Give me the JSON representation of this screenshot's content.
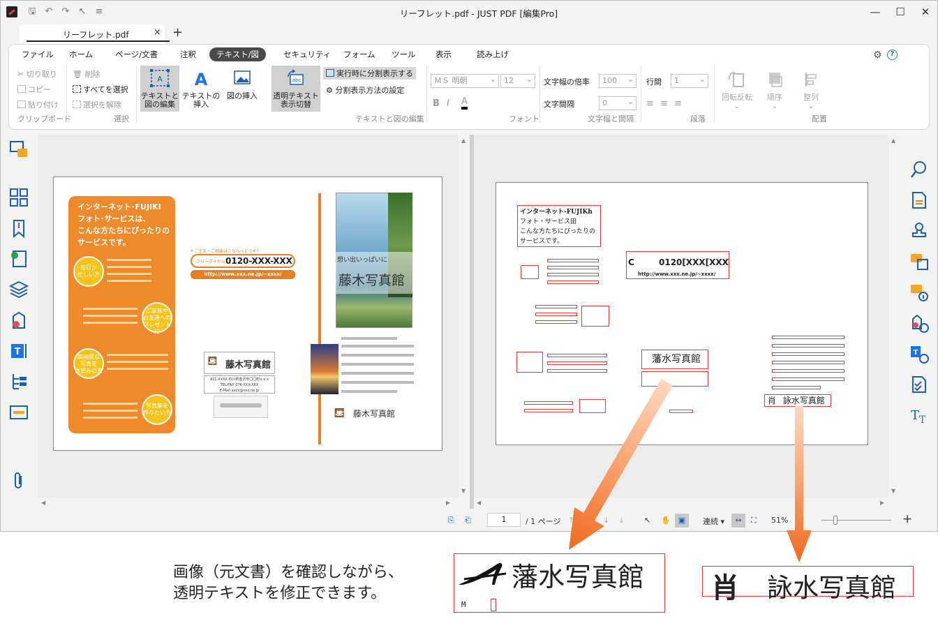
{
  "window": {
    "title": "リーフレット.pdf - JUST PDF [編集Pro]",
    "minimize": "—",
    "maximize": "☐",
    "close": "✕"
  },
  "tabs": {
    "doc_tab": "リーフレット.pdf",
    "close": "×",
    "new": "+"
  },
  "menu": [
    "ファイル",
    "ホーム",
    "ページ/文書",
    "注釈",
    "テキスト/図",
    "セキュリティ",
    "フォーム",
    "ツール",
    "表示",
    "読み上げ"
  ],
  "ribbon": {
    "clipboard": {
      "cut": "切り取り",
      "copy": "コピー",
      "paste": "貼り付け",
      "label": "クリップボード"
    },
    "select": {
      "delete": "削除",
      "select_all": "すべてを選択",
      "deselect": "選択を解除",
      "label": "選択"
    },
    "text_and_image": {
      "edit": "テキストと\n図の編集",
      "insert_text": "テキストの\n挿入",
      "insert_image": "図の挿入",
      "toggle_transparent": "透明テキスト\n表示切替",
      "split_display": "実行時に分割表示する",
      "split_settings": "分割表示方法の設定",
      "label": "テキストと図の編集"
    },
    "font": {
      "name": "ＭＳ 明朝",
      "size": "12",
      "bold": "B",
      "italic": "I",
      "color": "A",
      "label": "フォント"
    },
    "spacing": {
      "width_ratio_label": "文字幅の倍率",
      "width_ratio": "100",
      "char_spacing_label": "文字間隔",
      "char_spacing": "0",
      "label": "文字幅と間隔"
    },
    "paragraph": {
      "line_label": "行間",
      "line": "1",
      "label": "段落"
    },
    "arrange": {
      "rotate": "回転反転",
      "order": "順序",
      "align": "整列",
      "label": "配置"
    }
  },
  "leaflet": {
    "headline": [
      "インターネット･FUJIKI",
      "フォト･サービスは、",
      "こんな方たちにぴったりの",
      "サービスです。"
    ],
    "circles": [
      "毎日が\n忙しい方",
      "ご家族や\nお友達への\nプレゼントに",
      "高画質な\n写真を\nお望みの方",
      "写真集を\n作りたい方"
    ],
    "order_note": "＊ご注文・ご相談はこちらへどうぞ！",
    "free_dial": "フリーダイヤル",
    "phone": "0120-XXX-XXX",
    "url": "http://www.xxx.ne.jp/~xxxx/",
    "store_name": "藤木写真館",
    "vertical_text": "想い出いっぱいに",
    "address": "921-XXXX 石川県金沢市〇〇町x-x-x",
    "tel": "TEL/FAX 076-XXX-XXX",
    "email": "E-Mail xxxx@xxx.ne.jp"
  },
  "ocr": {
    "headline": [
      "インターネット-FUJIKh",
      "フォト・サービス田",
      "こんな方たちにぴったりの",
      "サービスです。"
    ],
    "phone": "0120[XXX[XXX",
    "phone_prefix": "C",
    "url": "http://www.xxx.ne.jp/~xxxx/",
    "store_a": "藩水写真館",
    "store_b": "詠水写真館",
    "store_b_prefix": "肖"
  },
  "status": {
    "page": "1",
    "total": "/ 1 ページ",
    "mode": "連続",
    "zoom": "51%",
    "plus": "+"
  },
  "caption": [
    "画像（元文書）を確認しながら、",
    "透明テキストを修正できます。"
  ],
  "callout_a": {
    "text": "藩水写真館",
    "sub": "M"
  },
  "callout_b": {
    "prefix": "肖",
    "text": "詠水写真館"
  }
}
